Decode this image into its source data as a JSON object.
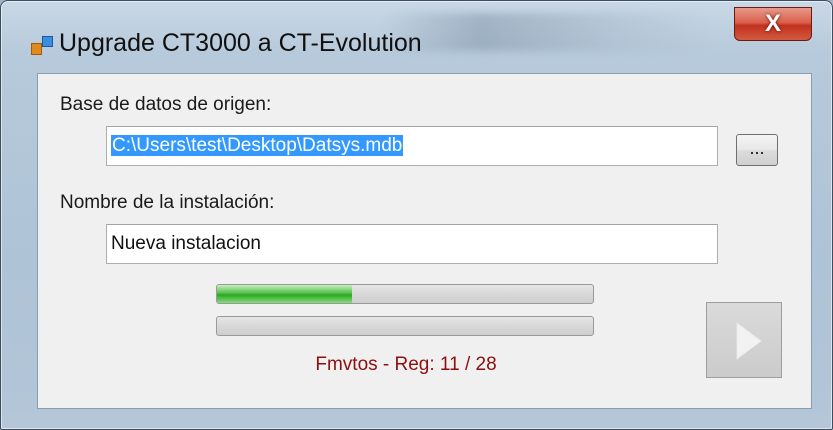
{
  "window": {
    "title": "Upgrade CT3000 a CT-Evolution",
    "close_glyph": "X"
  },
  "source": {
    "label": "Base de datos de origen:",
    "value": "C:\\Users\\test\\Desktop\\Datsys.mdb",
    "browse_label": "..."
  },
  "installation": {
    "label": "Nombre de la instalación:",
    "value": "Nueva instalacion"
  },
  "progress": {
    "primary_fraction": 0.36,
    "secondary_fraction": 0.0,
    "status_text": "Fmvtos - Reg: 11 / 28"
  },
  "icons": {
    "app": "app-window-icon",
    "close": "close-icon",
    "start": "play-icon"
  },
  "colors": {
    "progress_fill": "#2aa820",
    "status_text": "#8b1010",
    "selection": "#3399ff"
  }
}
